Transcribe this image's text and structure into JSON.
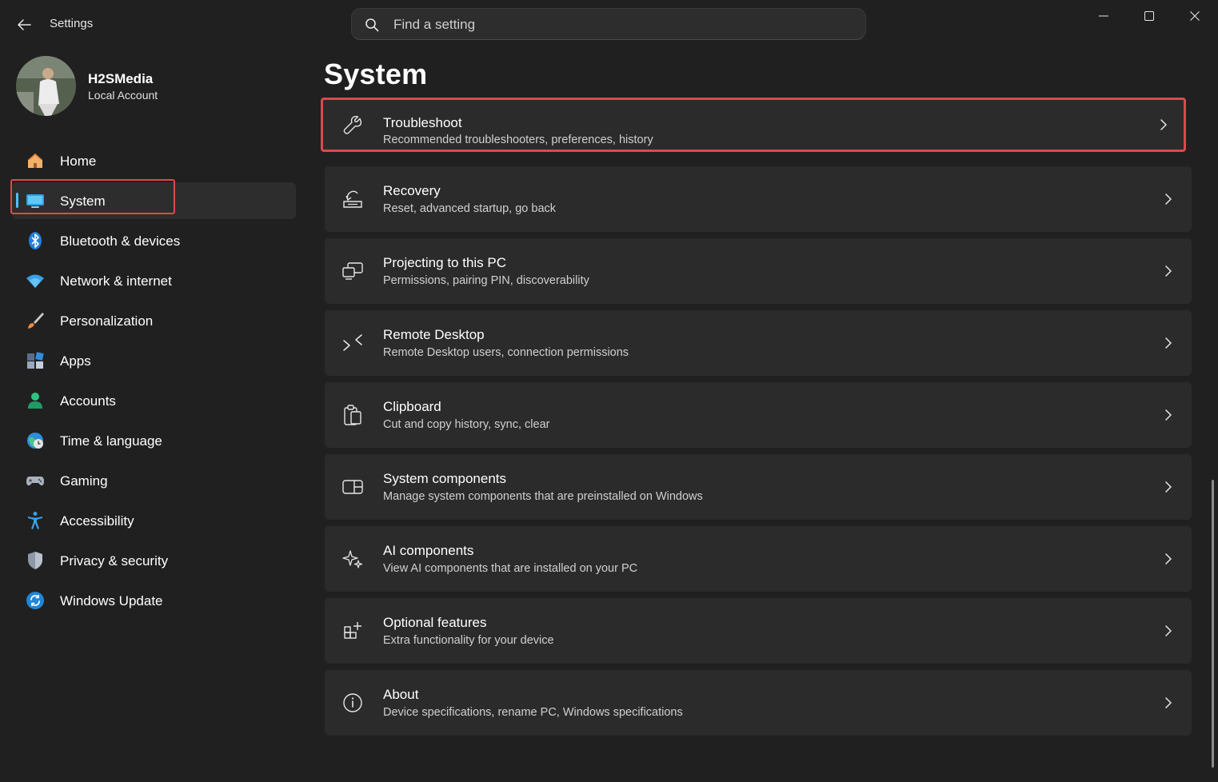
{
  "app": {
    "title": "Settings"
  },
  "search": {
    "placeholder": "Find a setting"
  },
  "profile": {
    "name": "H2SMedia",
    "account_type": "Local Account"
  },
  "nav": {
    "items": [
      {
        "label": "Home",
        "icon": "home-icon"
      },
      {
        "label": "System",
        "icon": "system-icon",
        "selected": true
      },
      {
        "label": "Bluetooth & devices",
        "icon": "bluetooth-icon"
      },
      {
        "label": "Network & internet",
        "icon": "wifi-icon"
      },
      {
        "label": "Personalization",
        "icon": "brush-icon"
      },
      {
        "label": "Apps",
        "icon": "apps-icon"
      },
      {
        "label": "Accounts",
        "icon": "accounts-icon"
      },
      {
        "label": "Time & language",
        "icon": "clock-globe-icon"
      },
      {
        "label": "Gaming",
        "icon": "gamepad-icon"
      },
      {
        "label": "Accessibility",
        "icon": "accessibility-icon"
      },
      {
        "label": "Privacy & security",
        "icon": "shield-icon"
      },
      {
        "label": "Windows Update",
        "icon": "update-icon"
      }
    ]
  },
  "main": {
    "title": "System",
    "cards": [
      {
        "title": "Troubleshoot",
        "subtitle": "Recommended troubleshooters, preferences, history",
        "icon": "wrench-icon"
      },
      {
        "title": "Recovery",
        "subtitle": "Reset, advanced startup, go back",
        "icon": "recovery-icon"
      },
      {
        "title": "Projecting to this PC",
        "subtitle": "Permissions, pairing PIN, discoverability",
        "icon": "projecting-icon"
      },
      {
        "title": "Remote Desktop",
        "subtitle": "Remote Desktop users, connection permissions",
        "icon": "remote-desktop-icon"
      },
      {
        "title": "Clipboard",
        "subtitle": "Cut and copy history, sync, clear",
        "icon": "clipboard-icon"
      },
      {
        "title": "System components",
        "subtitle": "Manage system components that are preinstalled on Windows",
        "icon": "system-components-icon"
      },
      {
        "title": "AI components",
        "subtitle": "View AI components that are installed on your PC",
        "icon": "sparkle-icon"
      },
      {
        "title": "Optional features",
        "subtitle": "Extra functionality for your device",
        "icon": "optional-features-icon"
      },
      {
        "title": "About",
        "subtitle": "Device specifications, rename PC, Windows specifications",
        "icon": "info-icon"
      }
    ]
  },
  "colors": {
    "accent": "#4cc2ff",
    "highlight_box": "#e0474c",
    "background": "#202020",
    "card": "#2b2b2b"
  }
}
